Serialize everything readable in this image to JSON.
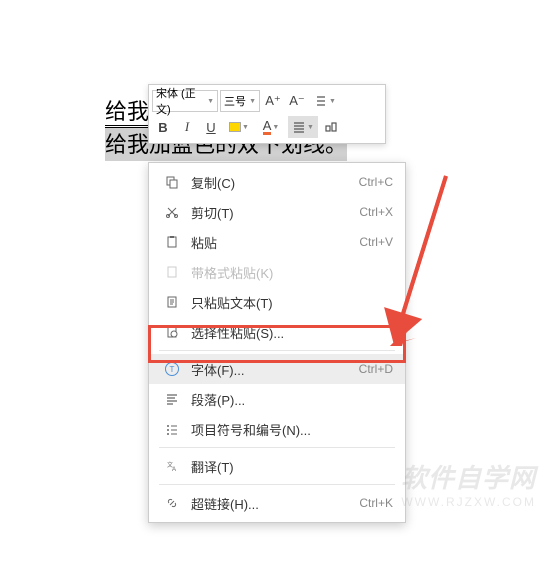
{
  "document": {
    "line1_prefix": "给我",
    "line2": "给我加蓝色的双下划线。"
  },
  "toolbar": {
    "font_name": "宋体 (正文)",
    "font_size": "三号",
    "increase_font": "A⁺",
    "decrease_font": "A⁻",
    "bold": "B",
    "italic": "I",
    "underline": "U",
    "font_color_letter": "A"
  },
  "menu": {
    "copy": {
      "label": "复制(C)",
      "shortcut": "Ctrl+C"
    },
    "cut": {
      "label": "剪切(T)",
      "shortcut": "Ctrl+X"
    },
    "paste": {
      "label": "粘贴",
      "shortcut": "Ctrl+V"
    },
    "paste_format": {
      "label": "带格式粘贴(K)"
    },
    "paste_text": {
      "label": "只粘贴文本(T)"
    },
    "paste_special": {
      "label": "选择性粘贴(S)..."
    },
    "font": {
      "label": "字体(F)...",
      "shortcut": "Ctrl+D"
    },
    "paragraph": {
      "label": "段落(P)..."
    },
    "bullets": {
      "label": "项目符号和编号(N)..."
    },
    "translate": {
      "label": "翻译(T)"
    },
    "hyperlink": {
      "label": "超链接(H)...",
      "shortcut": "Ctrl+K"
    }
  },
  "watermark": {
    "main": "软件自学网",
    "sub": "WWW.RJZXW.COM"
  }
}
